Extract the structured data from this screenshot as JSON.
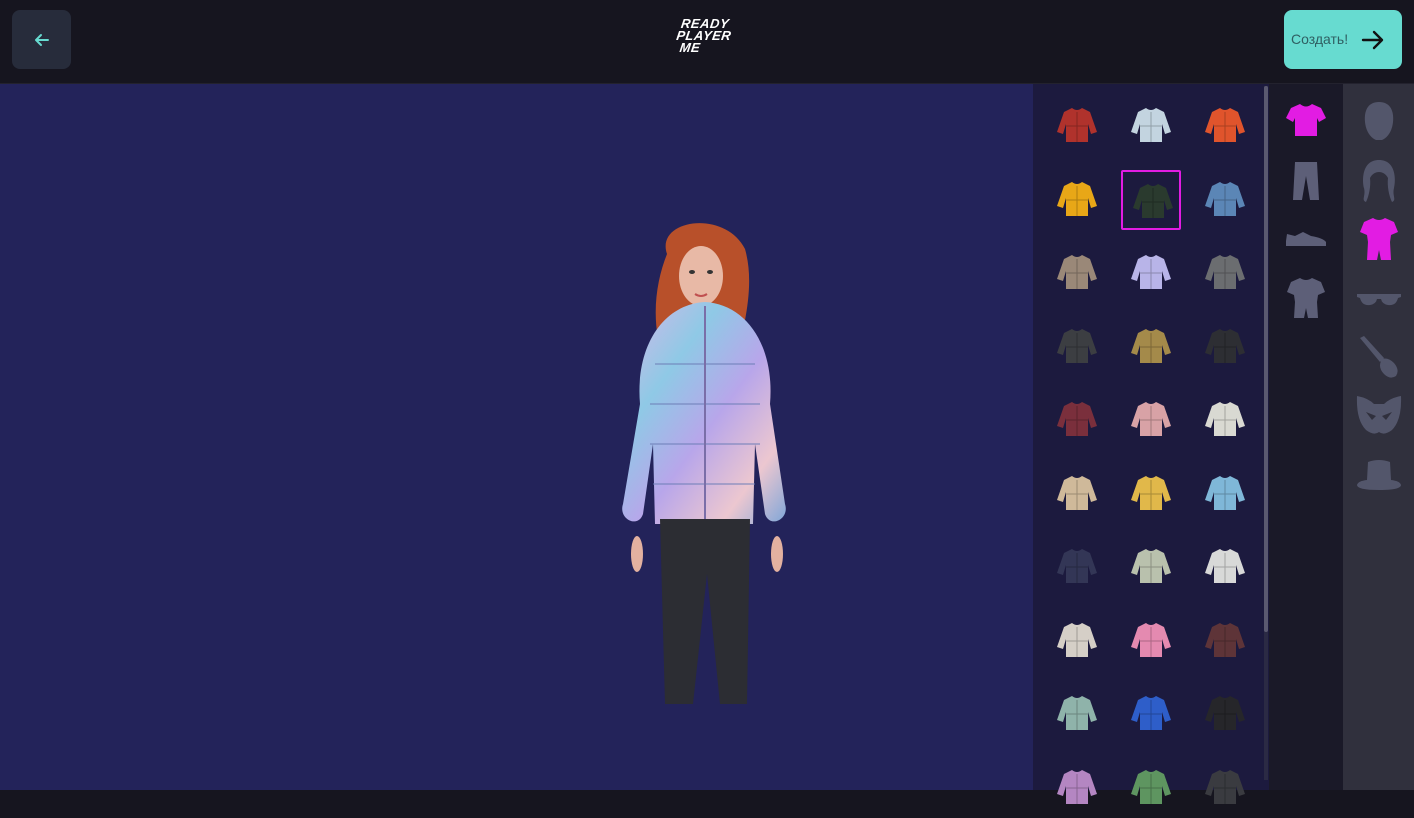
{
  "header": {
    "logo_lines": [
      "READY",
      "PLAYER",
      "ME"
    ],
    "create_label": "Создать!"
  },
  "colors": {
    "accent": "#67dbd0",
    "selection": "#e21ce3",
    "viewport_bg": "#23235a",
    "panel_bg": "#1c1a3e"
  },
  "outfit_grid": {
    "selected_index": 4,
    "items": [
      {
        "icon": "jacket-red-grey-icon",
        "color": "#b0322c"
      },
      {
        "icon": "tshirt-light-blue-icon",
        "color": "#c3d4e0"
      },
      {
        "icon": "puffer-orange-icon",
        "color": "#e0542c"
      },
      {
        "icon": "hoodie-yellow-icon",
        "color": "#e8a717"
      },
      {
        "icon": "jacket-black-neon-icon",
        "color": "#2a3a2e"
      },
      {
        "icon": "jacket-denim-icon",
        "color": "#5b86b6"
      },
      {
        "icon": "jacket-beige-icon",
        "color": "#9a8878"
      },
      {
        "icon": "puffer-holographic-icon",
        "color": "#b8b4e8"
      },
      {
        "icon": "jacket-grey-icon",
        "color": "#6b6d70"
      },
      {
        "icon": "parka-dark-icon",
        "color": "#3c3e42"
      },
      {
        "icon": "jacket-camo-icon",
        "color": "#a48a4a"
      },
      {
        "icon": "tshirt-black-icon",
        "color": "#2d2e33"
      },
      {
        "icon": "tshirt-maroon-icon",
        "color": "#7a2f3c"
      },
      {
        "icon": "hoodie-pink-teal-icon",
        "color": "#d8a2a6"
      },
      {
        "icon": "tshirt-white-print-icon",
        "color": "#d9d9d2"
      },
      {
        "icon": "sweater-cream-icon",
        "color": "#cfb99a"
      },
      {
        "icon": "jacket-yellow-blue-icon",
        "color": "#e1b84a"
      },
      {
        "icon": "jacket-blue-white-icon",
        "color": "#7fb7d8"
      },
      {
        "icon": "hoodie-navy-icon",
        "color": "#333656"
      },
      {
        "icon": "jacket-sage-icon",
        "color": "#b9c1ad"
      },
      {
        "icon": "jacket-white-icon",
        "color": "#d8d9d8"
      },
      {
        "icon": "jacket-cream-red-icon",
        "color": "#d5cfc7"
      },
      {
        "icon": "puffer-pink-icon",
        "color": "#e48ab0"
      },
      {
        "icon": "jacket-burgundy-icon",
        "color": "#5e3438"
      },
      {
        "icon": "hoodie-mint-icon",
        "color": "#8fb3aa"
      },
      {
        "icon": "sweater-blue-icon",
        "color": "#2e5ec9"
      },
      {
        "icon": "jacket-black-white-icon",
        "color": "#26262a"
      },
      {
        "icon": "jacket-floral-icon",
        "color": "#b486c2"
      },
      {
        "icon": "jacket-green-icon",
        "color": "#5e9560"
      },
      {
        "icon": "jacket-charcoal-icon",
        "color": "#3a3b40"
      }
    ]
  },
  "subcategories": [
    {
      "icon": "tshirt-icon",
      "active": true
    },
    {
      "icon": "pants-icon",
      "active": false
    },
    {
      "icon": "shoe-icon",
      "active": false
    },
    {
      "icon": "outfit-icon",
      "active": false
    }
  ],
  "categories": [
    {
      "icon": "head-icon",
      "active": false
    },
    {
      "icon": "hair-icon",
      "active": false
    },
    {
      "icon": "outfit-icon",
      "active": true
    },
    {
      "icon": "glasses-icon",
      "active": false
    },
    {
      "icon": "makeup-brush-icon",
      "active": false
    },
    {
      "icon": "mask-icon",
      "active": false
    },
    {
      "icon": "hat-icon",
      "active": false
    }
  ]
}
